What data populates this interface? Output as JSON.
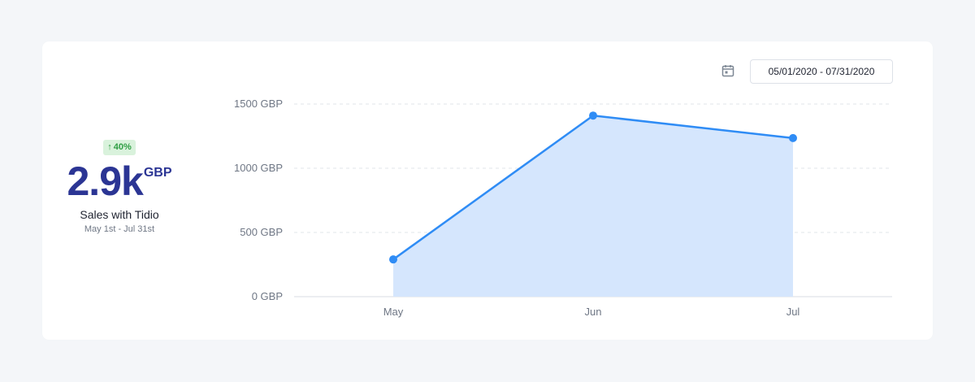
{
  "stat": {
    "badge": "40%",
    "value": "2.9k",
    "unit": "GBP",
    "label": "Sales with Tidio",
    "period": "May 1st - Jul 31st"
  },
  "date_range": "05/01/2020 - 07/31/2020",
  "colors": {
    "line": "#2f8cf5",
    "area": "#d5e6fd",
    "accent": "#2b3594",
    "badge_bg": "#d9f2dc",
    "badge_text": "#2f9e44"
  },
  "icons": {
    "badge": "arrow-up-icon",
    "date": "calendar-icon"
  },
  "chart_data": {
    "type": "area",
    "categories": [
      "May",
      "Jun",
      "Jul"
    ],
    "values": [
      290,
      1410,
      1235
    ],
    "ylim": [
      0,
      1500
    ],
    "yticks": [
      0,
      500,
      1000,
      1500
    ],
    "ytick_labels": [
      "0 GBP",
      "500 GBP",
      "1000 GBP",
      "1500 GBP"
    ],
    "grid": true,
    "legend": "none"
  }
}
